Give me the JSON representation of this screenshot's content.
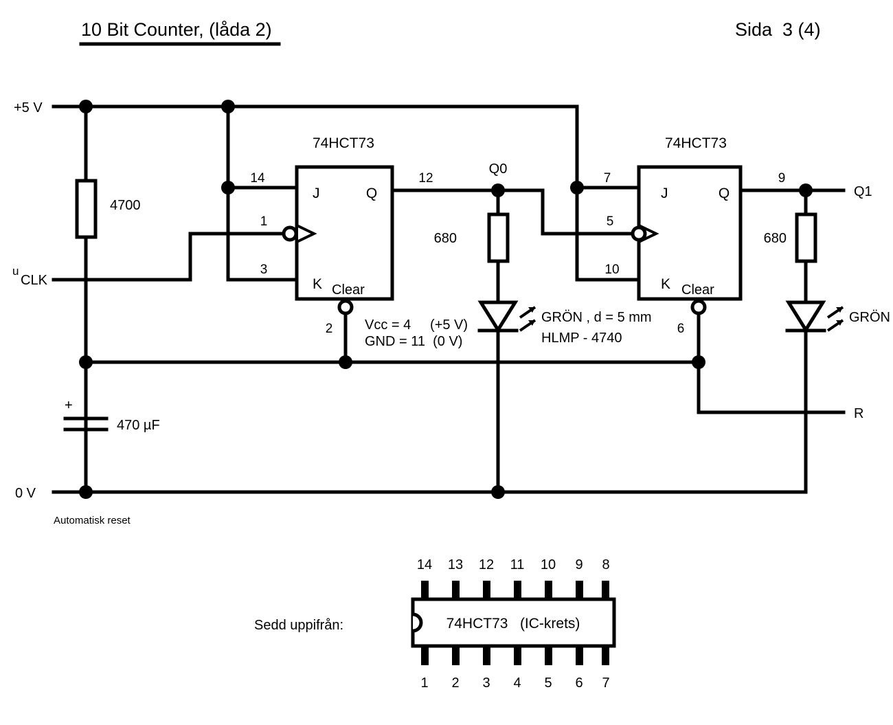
{
  "page": {
    "title": "10 Bit Counter, (låda 2)",
    "page_number": "Sida  3 (4)"
  },
  "rails": {
    "vcc_label": "+5 V",
    "gnd_label": "0 V",
    "clk_label_main": "u",
    "clk_label_sub": "CLK",
    "reset_label": "R",
    "reset_note": "Automatisk reset"
  },
  "components": {
    "pullup_resistor": "4700",
    "capacitor": "470 µF",
    "capacitor_polarity": "+",
    "led_resistor_1": "680",
    "led_resistor_2": "680"
  },
  "ff1": {
    "part": "74HCT73",
    "j_label": "J",
    "k_label": "K",
    "q_label": "Q",
    "clear_label": "Clear",
    "pin_j": "14",
    "pin_clk": "1",
    "pin_k": "3",
    "pin_q": "12",
    "pin_clear": "2",
    "power_note_1": "Vcc = 4     (+5 V)",
    "power_note_2": "GND = 11  (0 V)"
  },
  "ff2": {
    "part": "74HCT73",
    "j_label": "J",
    "k_label": "K",
    "q_label": "Q",
    "clear_label": "Clear",
    "pin_j": "7",
    "pin_clk": "5",
    "pin_k": "10",
    "pin_q": "9",
    "pin_clear": "6"
  },
  "outputs": {
    "q0": "Q0",
    "q1": "Q1"
  },
  "led1": {
    "color_note": "GRÖN , d = 5 mm",
    "part": "HLMP - 4740"
  },
  "led2": {
    "color_note": "GRÖN"
  },
  "package": {
    "view_label": "Sedd uppifrån:",
    "body_label": "74HCT73   (IC-krets)",
    "top_pins": [
      "14",
      "13",
      "12",
      "11",
      "10",
      "9",
      "8"
    ],
    "bottom_pins": [
      "1",
      "2",
      "3",
      "4",
      "5",
      "6",
      "7"
    ]
  },
  "colors": {
    "ink": "#000000",
    "paper": "#ffffff"
  }
}
